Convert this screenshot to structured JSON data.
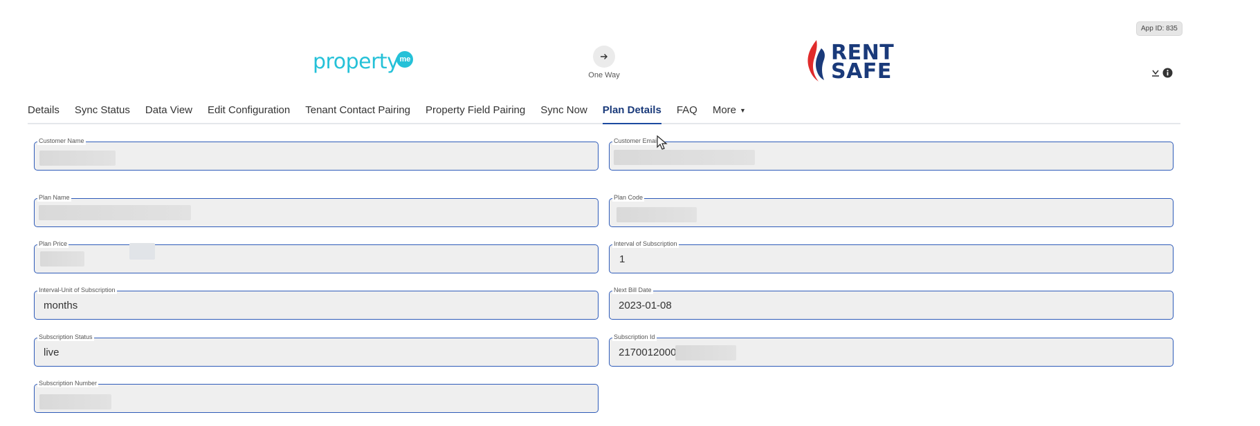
{
  "header": {
    "app_id": "App ID: 835",
    "left_logo_text": "property",
    "left_logo_badge": "me",
    "sync_direction_label": "One Way",
    "right_logo_line1": "RENT",
    "right_logo_line2": "SAFE",
    "icons": [
      "download-icon",
      "info-icon"
    ]
  },
  "tabs": [
    {
      "label": "Details"
    },
    {
      "label": "Sync Status"
    },
    {
      "label": "Data View"
    },
    {
      "label": "Edit Configuration"
    },
    {
      "label": "Tenant Contact Pairing"
    },
    {
      "label": "Property Field Pairing"
    },
    {
      "label": "Sync Now"
    },
    {
      "label": "Plan Details",
      "active": true
    },
    {
      "label": "FAQ"
    },
    {
      "label": "More"
    }
  ],
  "fields": {
    "customer_name": {
      "label": "Customer Name",
      "value": ""
    },
    "customer_email": {
      "label": "Customer Email",
      "value": ""
    },
    "plan_name": {
      "label": "Plan Name",
      "value": ""
    },
    "plan_code": {
      "label": "Plan Code",
      "value": ""
    },
    "plan_price": {
      "label": "Plan Price",
      "value": ""
    },
    "interval": {
      "label": "Interval of Subscription",
      "value": "1"
    },
    "interval_unit": {
      "label": "Interval-Unit of Subscription",
      "value": "months"
    },
    "next_bill_date": {
      "label": "Next Bill Date",
      "value": "2023-01-08"
    },
    "subscription_status": {
      "label": "Subscription Status",
      "value": "live"
    },
    "subscription_id": {
      "label": "Subscription Id",
      "value": "21700120000"
    },
    "subscription_number": {
      "label": "Subscription Number",
      "value": ""
    }
  },
  "colors": {
    "field_border": "#2d5ab8",
    "field_background": "#efefef",
    "active_tab": "#1a3a7a",
    "propertyme_brand": "#25c1d8",
    "rentsafe_navy": "#1a3a7a",
    "rentsafe_red": "#e02b2b"
  }
}
